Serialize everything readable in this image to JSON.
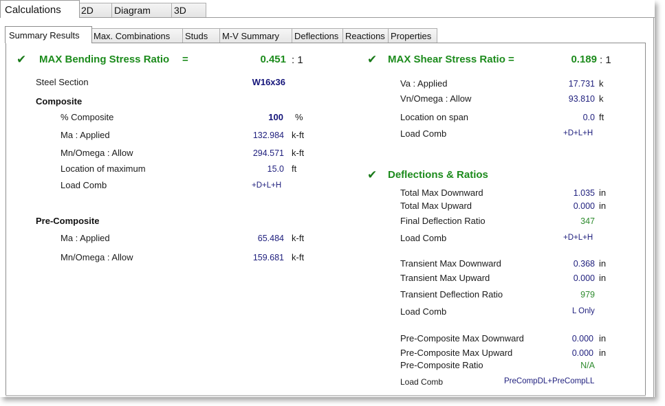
{
  "top_tabs": [
    "Calculations",
    "2D",
    "Diagram",
    "3D"
  ],
  "sub_tabs": [
    "Summary Results",
    "Max. Combinations",
    "Studs",
    "M-V Summary",
    "Deflections",
    "Reactions",
    "Properties"
  ],
  "bending": {
    "title": "MAX Bending Stress Ratio",
    "equals": "=",
    "ratio": "0.451",
    "ratio_suffix": ": 1",
    "steel_section_label": "Steel Section",
    "steel_section_value": "W16x36",
    "composite": {
      "heading": "Composite",
      "rows": [
        {
          "label": "% Composite",
          "value": "100",
          "unit": "%"
        },
        {
          "label": "Ma : Applied",
          "value": "132.984",
          "unit": "k-ft"
        },
        {
          "label": "Mn/Omega : Allow",
          "value": "294.571",
          "unit": "k-ft"
        },
        {
          "label": "Location of maximum",
          "value": "15.0",
          "unit": "ft"
        },
        {
          "label": "Load Comb",
          "value": "+D+L+H",
          "unit": ""
        }
      ]
    },
    "pre_composite": {
      "heading": "Pre-Composite",
      "rows": [
        {
          "label": "Ma : Applied",
          "value": "65.484",
          "unit": "k-ft"
        },
        {
          "label": "Mn/Omega : Allow",
          "value": "159.681",
          "unit": "k-ft"
        }
      ]
    }
  },
  "shear": {
    "title": "MAX Shear Stress Ratio =",
    "ratio": "0.189",
    "ratio_suffix": ": 1",
    "rows": [
      {
        "label": "Va : Applied",
        "value": "17.731",
        "unit": "k"
      },
      {
        "label": "Vn/Omega : Allow",
        "value": "93.810",
        "unit": "k"
      },
      {
        "label": "Location on span",
        "value": "0.0",
        "unit": "ft"
      },
      {
        "label": "Load Comb",
        "value": "+D+L+H",
        "unit": ""
      }
    ]
  },
  "deflections": {
    "title": "Deflections & Ratios",
    "rows": [
      {
        "label": "Total Max Downward",
        "value": "1.035",
        "unit": "in"
      },
      {
        "label": "Total Max Upward",
        "value": "0.000",
        "unit": "in"
      },
      {
        "label": "Final Deflection Ratio",
        "value": "347",
        "unit": ""
      },
      {
        "label": "Load Comb",
        "value": "+D+L+H",
        "unit": ""
      },
      {
        "label": "Transient Max Downward",
        "value": "0.368",
        "unit": "in"
      },
      {
        "label": "Transient Max Upward",
        "value": "0.000",
        "unit": "in"
      },
      {
        "label": "Transient Deflection Ratio",
        "value": "979",
        "unit": ""
      },
      {
        "label": "Load Comb",
        "value": "L Only",
        "unit": ""
      },
      {
        "label": "Pre-Composite Max Downward",
        "value": "0.000",
        "unit": "in"
      },
      {
        "label": "Pre-Composite Max Upward",
        "value": "0.000",
        "unit": "in"
      },
      {
        "label": "Pre-Composite Ratio",
        "value": "N/A",
        "unit": ""
      },
      {
        "label": "Load Comb",
        "value": "PreCompDL+PreCompLL",
        "unit": ""
      }
    ]
  },
  "icons": {
    "pass_check": "check-icon"
  },
  "colors": {
    "heading_green": "#1c8b1c",
    "value_navy": "#20207e",
    "ratio_green": "#2e8b2e"
  }
}
